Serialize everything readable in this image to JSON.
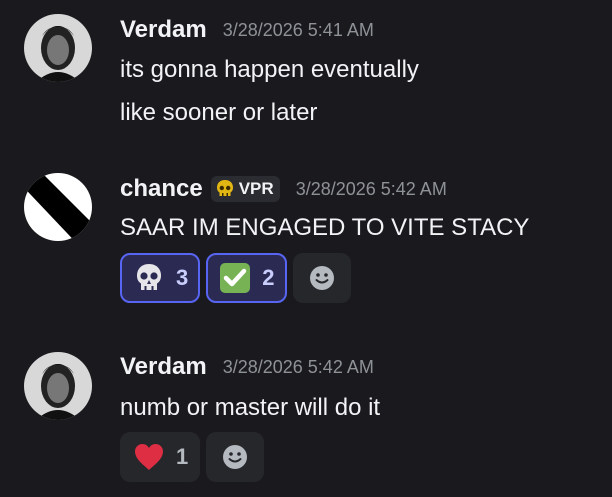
{
  "messages": [
    {
      "author": "Verdam",
      "timestamp": "3/28/2026 5:41 AM",
      "lines": [
        "its gonna happen eventually",
        "like sooner or later"
      ]
    },
    {
      "author": "chance",
      "tag": "VPR",
      "timestamp": "3/28/2026 5:42 AM",
      "lines": [
        "SAAR IM ENGAGED TO VITE STACY"
      ],
      "reactions": [
        {
          "emoji": "skull-icon",
          "count": "3"
        },
        {
          "emoji": "check-icon",
          "count": "2"
        }
      ]
    },
    {
      "author": "Verdam",
      "timestamp": "3/28/2026 5:42 AM",
      "lines": [
        "numb or master will do it"
      ],
      "reactions": [
        {
          "emoji": "heart-icon",
          "count": "1"
        }
      ]
    }
  ],
  "colors": {
    "background": "#1a1a1e",
    "reaction_active_border": "#5865f2",
    "reaction_active_bg": "#2a2a52"
  }
}
